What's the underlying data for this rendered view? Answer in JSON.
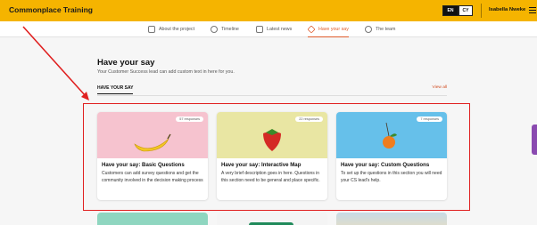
{
  "header": {
    "brand": "Commonplace Training",
    "lang_en": "EN",
    "lang_cy": "CY",
    "user_name": "Isabella Nweke"
  },
  "nav": {
    "items": [
      {
        "label": "About the project",
        "icon": "document-icon"
      },
      {
        "label": "Timeline",
        "icon": "clock-icon"
      },
      {
        "label": "Latest news",
        "icon": "megaphone-icon"
      },
      {
        "label": "Have your say",
        "icon": "layers-icon",
        "active": true
      },
      {
        "label": "The team",
        "icon": "people-icon"
      }
    ]
  },
  "page": {
    "title": "Have your say",
    "subtitle": "Your Customer Success lead can add custom text in here for you.",
    "tab_label": "HAVE YOUR SAY",
    "view_all": "View all"
  },
  "cards": [
    {
      "badge": "57 responses",
      "title": "Have your say: Basic Questions",
      "description": "Customers can add survey questions and get the community involved in the decision making process",
      "image": "banana",
      "bg_color": "#f6c3cf"
    },
    {
      "badge": "22 responses",
      "title": "Have your say: Interactive Map",
      "description": "A very brief description goes in here. Questions in this section need to be general and place specific.",
      "image": "strawberry",
      "bg_color": "#e9e6a3"
    },
    {
      "badge": "7 responses",
      "title": "Have your say: Custom Questions",
      "description": "To set up the questions in this section you will need your CS lead's help.",
      "image": "orange",
      "bg_color": "#66c0ea"
    }
  ],
  "colors": {
    "brand_yellow": "#f5b400",
    "accent_orange": "#e05b2a",
    "annotation_red": "#e02020"
  }
}
